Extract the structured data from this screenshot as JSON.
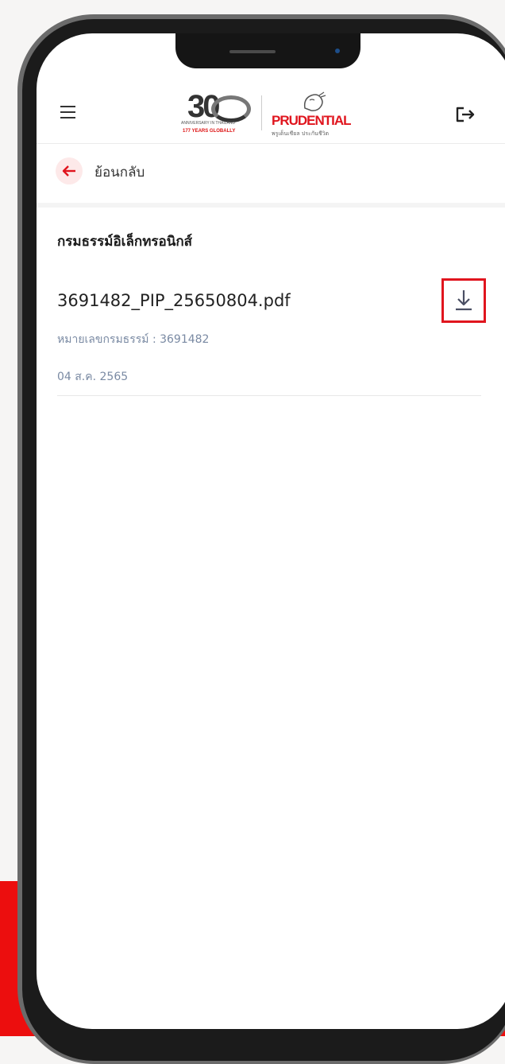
{
  "header": {
    "anniversary_number": "30",
    "anniversary_text": "ANNIVERSARY IN THAILAND",
    "anniversary_years": "177 YEARS GLOBALLY",
    "brand_name": "PRUDENTIAL",
    "brand_tagline": "พรูเด็นเชียล ประกันชีวิต",
    "menu_icon": "hamburger-menu-icon",
    "logout_icon": "logout-icon"
  },
  "nav": {
    "back_label": "ย้อนกลับ",
    "back_icon": "arrow-left-icon"
  },
  "section": {
    "title": "กรมธรรม์อิเล็กทรอนิกส์"
  },
  "files": [
    {
      "filename": "3691482_PIP_25650804.pdf",
      "policy_line": "หมายเลขกรมธรรม์ : 3691482",
      "date": "04 ส.ค. 2565",
      "action_icon": "download-icon"
    }
  ],
  "colors": {
    "brand_red": "#e0151e",
    "highlight_box": "#e0151e",
    "meta_text": "#7a8aa3",
    "background_band": "#ec0e0e"
  }
}
